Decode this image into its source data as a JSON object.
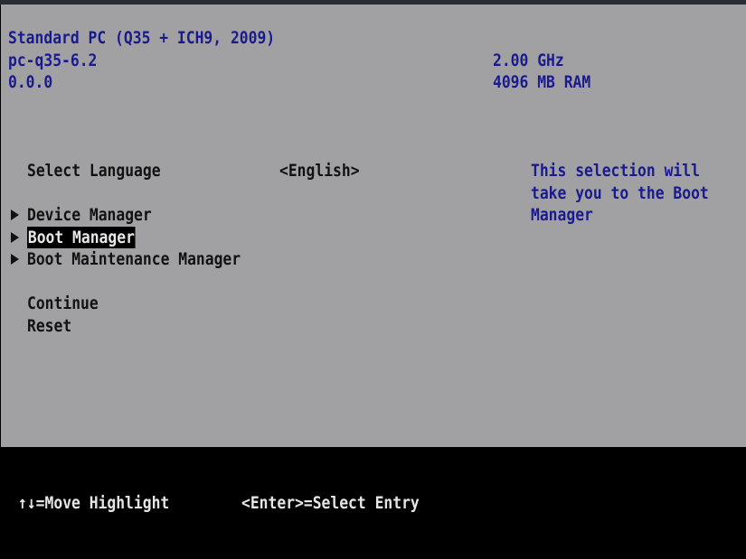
{
  "system_info": {
    "machine": "Standard PC (Q35 + ICH9, 2009)",
    "version": "pc-q35-6.2",
    "firmware": "0.0.0",
    "cpu_speed": "2.00 GHz",
    "memory": "4096 MB RAM"
  },
  "menu": {
    "language_label": "Select Language",
    "language_value": "<English>",
    "items": [
      {
        "label": "Device Manager"
      },
      {
        "label": "Boot Manager"
      },
      {
        "label": "Boot Maintenance Manager"
      }
    ],
    "continue_label": "Continue",
    "reset_label": "Reset",
    "selected": "Boot Manager"
  },
  "help_text": {
    "line1": "This selection will",
    "line2": "take you to the Boot",
    "line3": "Manager"
  },
  "footer": {
    "move_hint": "↑↓=Move Highlight",
    "select_hint": "<Enter>=Select Entry"
  },
  "colors": {
    "panel": "#a1a1a3",
    "info_text": "#1a1a8f",
    "menu_text": "#111111",
    "highlight_bg": "#000000",
    "footer_bg": "#000000"
  }
}
